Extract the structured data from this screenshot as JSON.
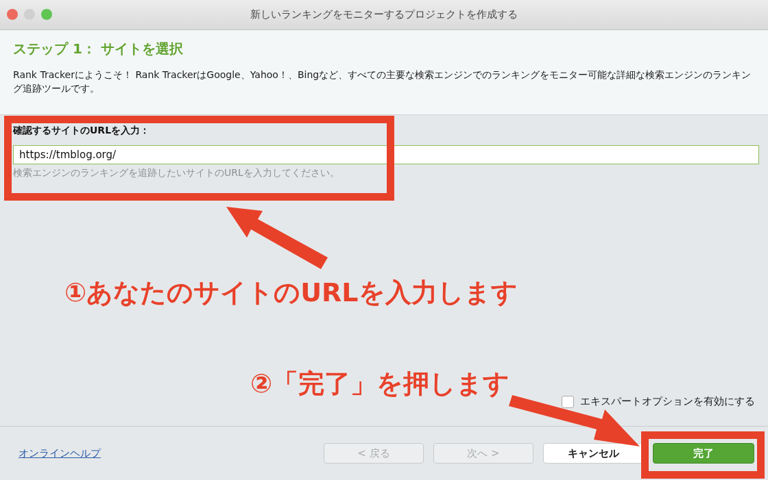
{
  "window": {
    "title": "新しいランキングをモニターするプロジェクトを作成する"
  },
  "header": {
    "step_title": "ステップ 1： サイトを選択",
    "intro": "Rank Trackerにようこそ！ Rank TrackerはGoogle、Yahoo！、Bingなど、すべての主要な検索エンジンでのランキングをモニター可能な詳細な検索エンジンのランキング追跡ツールです。"
  },
  "url_field": {
    "label": "確認するサイトのURLを入力：",
    "value": "https://tmblog.org/",
    "hint": "検索エンジンのランキングを追跡したいサイトのURLを入力してください。"
  },
  "expert_option": {
    "label": "エキスパートオプションを有効にする",
    "checked": false
  },
  "footer": {
    "help_link": "オンラインヘルプ",
    "buttons": [
      {
        "label": "< 戻る",
        "kind": "normal",
        "disabled": true
      },
      {
        "label": "次へ >",
        "kind": "normal",
        "disabled": true
      },
      {
        "label": "キャンセル",
        "kind": "normal",
        "disabled": false
      },
      {
        "label": "完了",
        "kind": "primary",
        "disabled": false
      }
    ]
  },
  "annotations": [
    {
      "text": "①あなたのサイトのURLを入力します"
    },
    {
      "text": "②「完了」を押します"
    }
  ]
}
